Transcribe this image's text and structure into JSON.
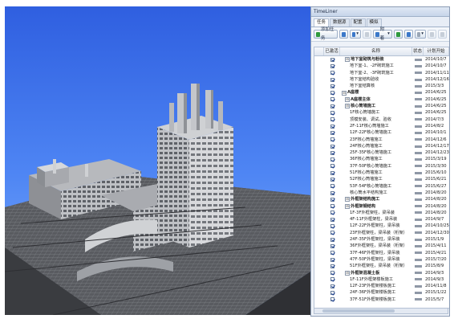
{
  "panel": {
    "title": "TimeLiner",
    "tabs": [
      "任务",
      "数据源",
      "配置",
      "模拟"
    ],
    "toolbar": {
      "add_task": "添加任务",
      "attach": "附着"
    },
    "columns": [
      "",
      "已激活",
      "名称",
      "状态",
      "计划开始"
    ]
  },
  "tasks": [
    {
      "name": "地下室砌筑与粉装",
      "level": 1,
      "bold": true,
      "expander": "⊟",
      "date": "2014/10/7"
    },
    {
      "name": "地下室-1、-2F砌筑施工",
      "level": 2,
      "date": "2014/10/7"
    },
    {
      "name": "地下室-2、-3F砌筑施工",
      "level": 2,
      "date": "2014/11/11"
    },
    {
      "name": "地下室结构验收",
      "level": 2,
      "date": "2014/12/16"
    },
    {
      "name": "地下室结算核",
      "level": 2,
      "date": "2015/3/3"
    },
    {
      "name": "A座楼",
      "level": 0,
      "bold": true,
      "expander": "⊟",
      "date": "2014/6/25"
    },
    {
      "name": "A座楼主体",
      "level": 1,
      "bold": true,
      "expander": "⊟",
      "date": "2014/6/25"
    },
    {
      "name": "核心筒墙施工",
      "level": 1,
      "bold": true,
      "expander": "⊟",
      "date": "2014/6/25"
    },
    {
      "name": "1F核心筒墙施工",
      "level": 2,
      "date": "2014/6/25"
    },
    {
      "name": "顶模安装、调试、验收",
      "level": 2,
      "date": "2014/7/3"
    },
    {
      "name": "2F-11F核心筒墙施工",
      "level": 2,
      "date": "2014/8/2"
    },
    {
      "name": "12F-22F核心筒墙施工",
      "level": 2,
      "date": "2014/10/1"
    },
    {
      "name": "23F核心筒墙施工",
      "level": 2,
      "date": "2014/12/6"
    },
    {
      "name": "24F核心筒墙施工",
      "level": 2,
      "date": "2014/12/17"
    },
    {
      "name": "25F-35F核心筒墙施工",
      "level": 2,
      "date": "2014/12/23"
    },
    {
      "name": "36F核心筒墙施工",
      "level": 2,
      "date": "2015/3/19"
    },
    {
      "name": "37F-50F核心筒墙施工",
      "level": 2,
      "date": "2015/3/30"
    },
    {
      "name": "51F核心筒墙施工",
      "level": 2,
      "date": "2015/6/10"
    },
    {
      "name": "52F核心筒墙施工",
      "level": 2,
      "date": "2015/6/21"
    },
    {
      "name": "53F-54F核心筒墙施工",
      "level": 2,
      "date": "2015/6/27"
    },
    {
      "name": "核心筒水平结构施工",
      "level": 2,
      "date": "2014/8/20"
    },
    {
      "name": "外框架结构施工",
      "level": 1,
      "bold": true,
      "expander": "⊟",
      "date": "2014/8/20"
    },
    {
      "name": "外框架钢结构",
      "level": 1,
      "bold": true,
      "expander": "⊟",
      "date": "2014/8/20"
    },
    {
      "name": "1F-3F外框架柱，梁吊装",
      "level": 2,
      "date": "2014/8/20"
    },
    {
      "name": "4F-11F外框架柱，梁吊装",
      "level": 2,
      "date": "2014/9/7"
    },
    {
      "name": "12F-22F外框架柱，梁吊装",
      "level": 2,
      "date": "2014/10/25"
    },
    {
      "name": "23F外框架柱，梁吊装（桁架）",
      "level": 2,
      "date": "2014/12/30"
    },
    {
      "name": "24F-35F外框架柱，梁吊装",
      "level": 2,
      "date": "2015/1/9"
    },
    {
      "name": "36F外框架柱，梁吊装（桁架）",
      "level": 2,
      "date": "2015/4/11"
    },
    {
      "name": "37F-46F外框架柱，梁吊装",
      "level": 2,
      "date": "2015/4/21"
    },
    {
      "name": "47F-50F外框架柱，梁吊装",
      "level": 2,
      "date": "2015/7/20"
    },
    {
      "name": "51F外框架柱，梁吊装（桁架）",
      "level": 2,
      "date": "2015/8/9"
    },
    {
      "name": "外框架混凝土板",
      "level": 1,
      "bold": true,
      "expander": "⊟",
      "date": "2014/9/3"
    },
    {
      "name": "1F-11F外框架楼板施工",
      "level": 2,
      "date": "2014/9/3"
    },
    {
      "name": "12F-23F外框架楼板施工",
      "level": 2,
      "date": "2014/11/8"
    },
    {
      "name": "24F-36F外框架楼板施工",
      "level": 2,
      "date": "2015/1/22"
    },
    {
      "name": "37F-51F外框架楼板施工",
      "level": 2,
      "date": "2015/5/7"
    }
  ],
  "colors": {
    "sky_top": "#2f5fe0",
    "sky_bottom": "#7fb0fb",
    "model_gray": "#c6c8cc"
  }
}
